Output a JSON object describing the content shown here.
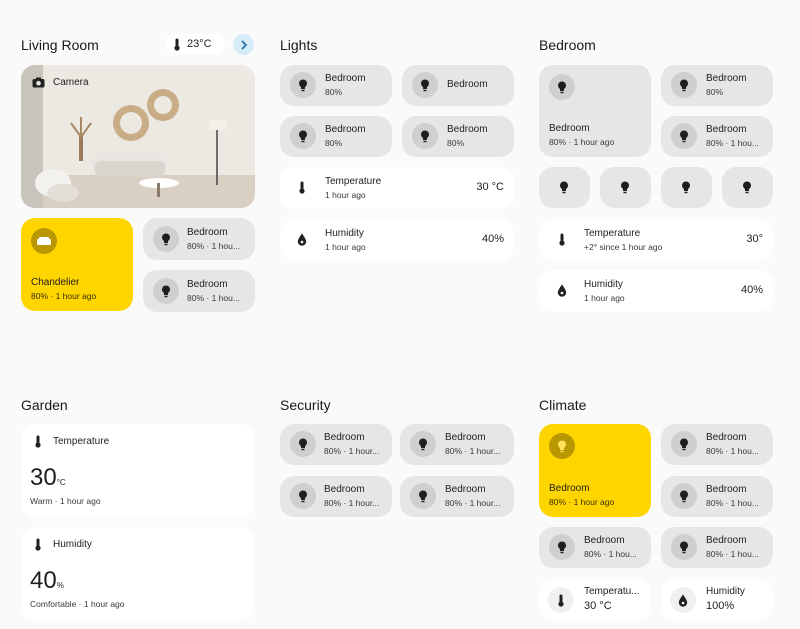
{
  "living_room": {
    "title": "Living Room",
    "temp_badge": "23°C",
    "camera_label": "Camera",
    "chandelier": {
      "title": "Chandelier",
      "sub": "80% · 1 hour ago"
    },
    "tiles": [
      {
        "title": "Bedroom",
        "sub": "80% · 1 hou..."
      },
      {
        "title": "Bedroom",
        "sub": "80% · 1 hou..."
      }
    ]
  },
  "lights": {
    "title": "Lights",
    "tiles": [
      {
        "title": "Bedroom",
        "sub": "80%"
      },
      {
        "title": "Bedroom",
        "sub": ""
      },
      {
        "title": "Bedroom",
        "sub": "80%"
      },
      {
        "title": "Bedroom",
        "sub": "80%"
      }
    ],
    "temperature": {
      "title": "Temperature",
      "sub": "1 hour ago",
      "value": "30 °C"
    },
    "humidity": {
      "title": "Humidity",
      "sub": "1 hour ago",
      "value": "40%"
    }
  },
  "bedroom": {
    "title": "Bedroom",
    "big_tile": {
      "title": "Bedroom",
      "sub": "80% · 1 hour ago"
    },
    "tiles": [
      {
        "title": "Bedroom",
        "sub": "80%"
      },
      {
        "title": "Bedroom",
        "sub": "80% · 1 hou..."
      }
    ],
    "temperature": {
      "title": "Temperature",
      "sub": "+2° since 1 hour ago",
      "value": "30°"
    },
    "humidity": {
      "title": "Humidity",
      "sub": "1 hour ago",
      "value": "40%"
    }
  },
  "garden": {
    "title": "Garden",
    "temperature": {
      "title": "Temperature",
      "value": "30",
      "unit": "°C",
      "sub": "Warm · 1 hour ago"
    },
    "humidity": {
      "title": "Humidity",
      "value": "40",
      "unit": "%",
      "sub": "Comfortable · 1 hour ago"
    }
  },
  "security": {
    "title": "Security",
    "tiles": [
      {
        "title": "Bedroom",
        "sub": "80% · 1 hour..."
      },
      {
        "title": "Bedroom",
        "sub": "80% · 1 hour..."
      },
      {
        "title": "Bedroom",
        "sub": "80% · 1 hour..."
      },
      {
        "title": "Bedroom",
        "sub": "80% · 1 hour..."
      }
    ]
  },
  "climate": {
    "title": "Climate",
    "big_tile": {
      "title": "Bedroom",
      "sub": "80% · 1 hour ago"
    },
    "tiles": [
      {
        "title": "Bedroom",
        "sub": "80% · 1 hou..."
      },
      {
        "title": "Bedroom",
        "sub": "80% · 1 hou..."
      },
      {
        "title": "Bedroom",
        "sub": "80% · 1 hou..."
      },
      {
        "title": "Bedroom",
        "sub": "80% · 1 hou..."
      }
    ],
    "temperature": {
      "title": "Temperatu...",
      "value": "30 °C"
    },
    "humidity": {
      "title": "Humidity",
      "value": "100%"
    }
  },
  "colors": {
    "accent": "#ffd500",
    "tile": "#e6e6e6",
    "card": "#ffffff",
    "background": "#fafafa"
  }
}
